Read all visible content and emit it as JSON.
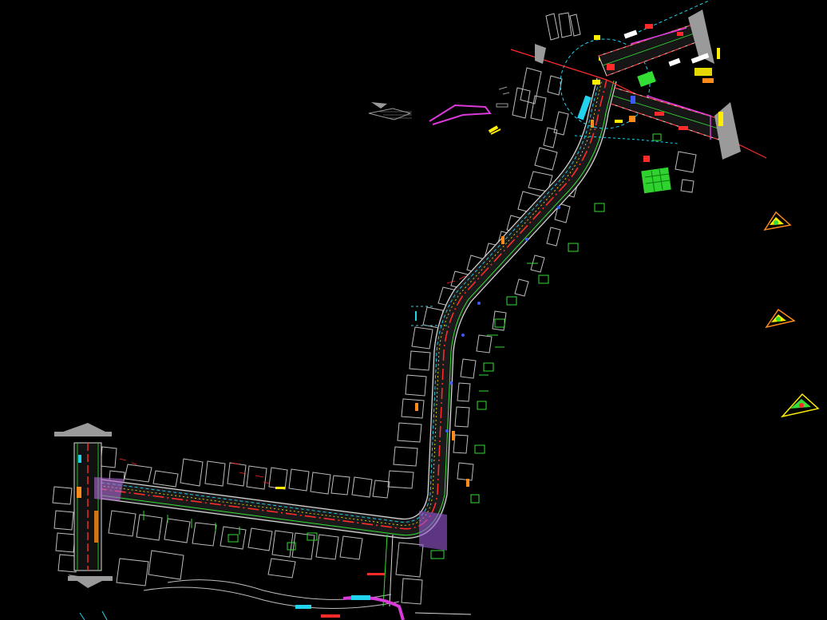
{
  "canvas": {
    "background": "#000000"
  },
  "colors": {
    "road_edge": "#d9d9d9",
    "centerline": "#ff2a2a",
    "green": "#33dd33",
    "yellow": "#ffee00",
    "cyan": "#22d3ee",
    "magenta": "#d93ad9",
    "orange": "#ff8c1a",
    "building": "#bdbdbd",
    "arrow_fill": "#9a9a9a",
    "blue": "#3b5bff"
  },
  "layers": [
    "buildings",
    "road",
    "centerline",
    "markings",
    "annotations",
    "north-plaza",
    "side-details"
  ]
}
